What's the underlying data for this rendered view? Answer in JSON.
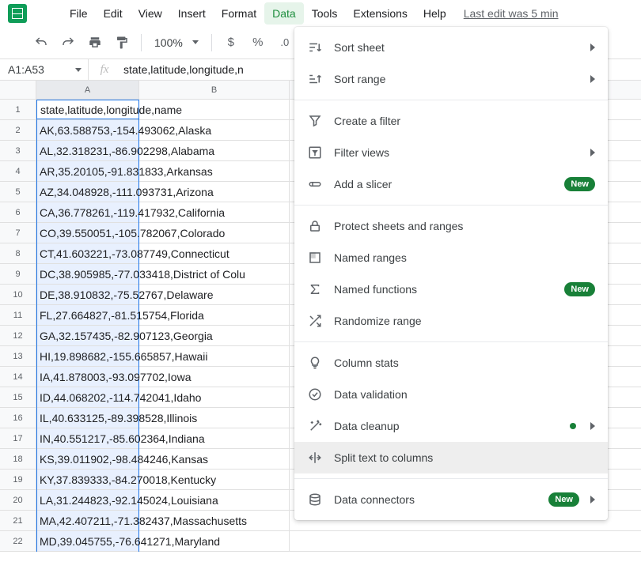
{
  "menubar": {
    "items": [
      "File",
      "Edit",
      "View",
      "Insert",
      "Format",
      "Data",
      "Tools",
      "Extensions",
      "Help"
    ],
    "active_index": 5,
    "last_edit": "Last edit was 5 min"
  },
  "toolbar": {
    "zoom": "100%",
    "currency": "$",
    "percent": "%",
    "decimal": ".0"
  },
  "namebox": "A1:A53",
  "formula": "state,latitude,longitude,n",
  "columns": [
    "A",
    "B"
  ],
  "rows": [
    {
      "n": "1",
      "a": "state,latitude,longitude,name"
    },
    {
      "n": "2",
      "a": "AK,63.588753,-154.493062,Alaska"
    },
    {
      "n": "3",
      "a": "AL,32.318231,-86.902298,Alabama"
    },
    {
      "n": "4",
      "a": "AR,35.20105,-91.831833,Arkansas"
    },
    {
      "n": "5",
      "a": "AZ,34.048928,-111.093731,Arizona"
    },
    {
      "n": "6",
      "a": "CA,36.778261,-119.417932,California"
    },
    {
      "n": "7",
      "a": "CO,39.550051,-105.782067,Colorado"
    },
    {
      "n": "8",
      "a": "CT,41.603221,-73.087749,Connecticut"
    },
    {
      "n": "9",
      "a": "DC,38.905985,-77.033418,District of Colu"
    },
    {
      "n": "10",
      "a": "DE,38.910832,-75.52767,Delaware"
    },
    {
      "n": "11",
      "a": "FL,27.664827,-81.515754,Florida"
    },
    {
      "n": "12",
      "a": "GA,32.157435,-82.907123,Georgia"
    },
    {
      "n": "13",
      "a": "HI,19.898682,-155.665857,Hawaii"
    },
    {
      "n": "14",
      "a": "IA,41.878003,-93.097702,Iowa"
    },
    {
      "n": "15",
      "a": "ID,44.068202,-114.742041,Idaho"
    },
    {
      "n": "16",
      "a": "IL,40.633125,-89.398528,Illinois"
    },
    {
      "n": "17",
      "a": "IN,40.551217,-85.602364,Indiana"
    },
    {
      "n": "18",
      "a": "KS,39.011902,-98.484246,Kansas"
    },
    {
      "n": "19",
      "a": "KY,37.839333,-84.270018,Kentucky"
    },
    {
      "n": "20",
      "a": "LA,31.244823,-92.145024,Louisiana"
    },
    {
      "n": "21",
      "a": "MA,42.407211,-71.382437,Massachusetts"
    },
    {
      "n": "22",
      "a": "MD,39.045755,-76.641271,Maryland"
    }
  ],
  "dropdown": {
    "groups": [
      [
        {
          "id": "sort-sheet",
          "label": "Sort sheet",
          "icon": "sort-desc",
          "sub": true
        },
        {
          "id": "sort-range",
          "label": "Sort range",
          "icon": "sort-asc",
          "sub": true
        }
      ],
      [
        {
          "id": "create-filter",
          "label": "Create a filter",
          "icon": "filter"
        },
        {
          "id": "filter-views",
          "label": "Filter views",
          "icon": "filter-views",
          "sub": true
        },
        {
          "id": "add-slicer",
          "label": "Add a slicer",
          "icon": "slicer",
          "new": true
        }
      ],
      [
        {
          "id": "protect",
          "label": "Protect sheets and ranges",
          "icon": "lock"
        },
        {
          "id": "named-ranges",
          "label": "Named ranges",
          "icon": "named-ranges"
        },
        {
          "id": "named-functions",
          "label": "Named functions",
          "icon": "sigma",
          "new": true
        },
        {
          "id": "randomize",
          "label": "Randomize range",
          "icon": "shuffle"
        }
      ],
      [
        {
          "id": "column-stats",
          "label": "Column stats",
          "icon": "bulb"
        },
        {
          "id": "data-validation",
          "label": "Data validation",
          "icon": "check-circle"
        },
        {
          "id": "data-cleanup",
          "label": "Data cleanup",
          "icon": "wand",
          "dot": true,
          "sub": true
        },
        {
          "id": "split-text",
          "label": "Split text to columns",
          "icon": "split",
          "highlight": true
        }
      ],
      [
        {
          "id": "data-connectors",
          "label": "Data connectors",
          "icon": "db",
          "new": true,
          "sub": true
        }
      ]
    ],
    "new_label": "New"
  }
}
